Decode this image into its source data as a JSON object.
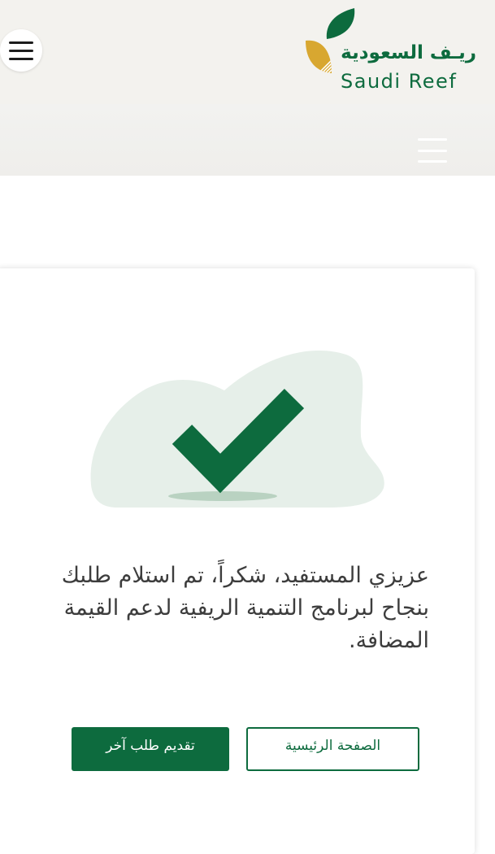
{
  "header": {
    "menu_icon": "hamburger-menu-icon",
    "logo": {
      "name_ar": "ريـف السعودية",
      "name_en": "Saudi Reef",
      "colors": {
        "green": "#0d6b3e",
        "gold": "#d8a730"
      }
    }
  },
  "subbar": {
    "menu_icon": "hamburger-menu-icon"
  },
  "confirmation": {
    "icon": "checkmark-icon",
    "message": "عزيزي المستفيد، شكراً، تم استلام طلبك بنجاح لبرنامج التنمية الريفية لدعم القيمة المضافة."
  },
  "buttons": {
    "new_request_label": "تقديم طلب آخر",
    "home_label": "الصفحة الرئيسية"
  },
  "colors": {
    "brand_green": "#0d6b3e",
    "header_bg": "#f3f2ee",
    "blob": "#e6efe9"
  }
}
